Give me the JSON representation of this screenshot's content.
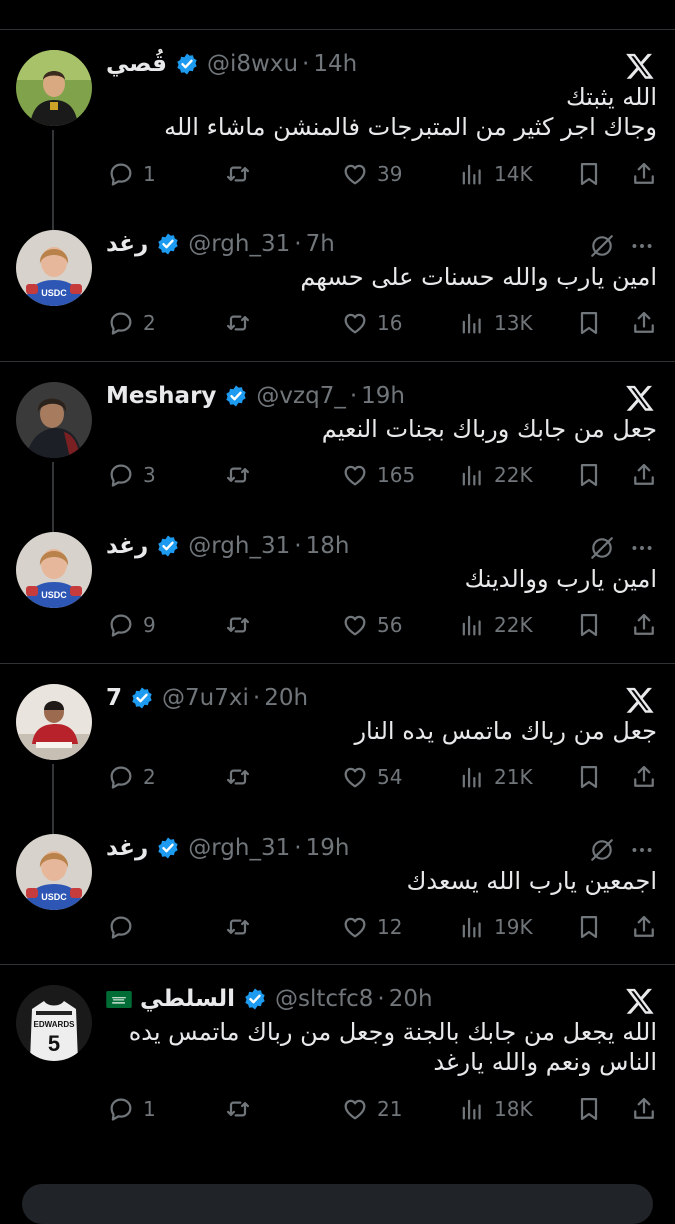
{
  "threads": [
    {
      "tweets": [
        {
          "name": "قُصي",
          "handle": "@i8wxu",
          "time": "14h",
          "verified": true,
          "top_icon": "x-logo-icon",
          "text_lines": [
            "الله يثبتك",
            "وجاك اجر كثير من المتبرجات فالمنشن ماشاء الله"
          ],
          "replies": "1",
          "likes": "39",
          "views": "14K"
        },
        {
          "name": "رغد",
          "handle": "@rgh_31",
          "time": "7h",
          "verified": true,
          "top_icon": "grok-icon",
          "text_lines": [
            "امين يارب والله حسنات على حسهم"
          ],
          "replies": "2",
          "likes": "16",
          "views": "13K"
        }
      ]
    },
    {
      "tweets": [
        {
          "name": "Meshary",
          "handle": "@vzq7_",
          "time": "19h",
          "verified": true,
          "top_icon": "x-logo-icon",
          "text_lines": [
            "جعل من جابك ورباك بجنات النعيم"
          ],
          "replies": "3",
          "likes": "165",
          "views": "22K"
        },
        {
          "name": "رغد",
          "handle": "@rgh_31",
          "time": "18h",
          "verified": true,
          "top_icon": "grok-icon",
          "text_lines": [
            "امين يارب ووالدينك"
          ],
          "replies": "9",
          "likes": "56",
          "views": "22K"
        }
      ]
    },
    {
      "tweets": [
        {
          "name": "7",
          "handle": "@7u7xi",
          "time": "20h",
          "verified": true,
          "top_icon": "x-logo-icon",
          "text_lines": [
            "جعل من رباك ماتمس يده النار"
          ],
          "replies": "2",
          "likes": "54",
          "views": "21K"
        },
        {
          "name": "رغد",
          "handle": "@rgh_31",
          "time": "19h",
          "verified": true,
          "top_icon": "grok-icon",
          "text_lines": [
            "اجمعين يارب الله يسعدك"
          ],
          "replies": "",
          "likes": "12",
          "views": "19K"
        }
      ]
    },
    {
      "tweets": [
        {
          "name": "السلطي",
          "handle": "@sltcfc8",
          "time": "20h",
          "verified": true,
          "top_icon": "x-logo-icon",
          "flag": "saudi-flag-icon",
          "text_lines": [
            "الله يجعل من جابك بالجنة وجعل من رباك ماتمس يده",
            "الناس ونعم والله يارغد"
          ],
          "replies": "1",
          "likes": "21",
          "views": "18K"
        }
      ]
    }
  ],
  "avatar_texts": {
    "usdc": "USDC",
    "jersey_name": "EDWARDS",
    "jersey_number": "5"
  },
  "colors": {
    "background": "#000000",
    "text": "#e7e9ea",
    "muted": "#71767b",
    "verified": "#1d9bf0",
    "divider": "#2f3336"
  }
}
